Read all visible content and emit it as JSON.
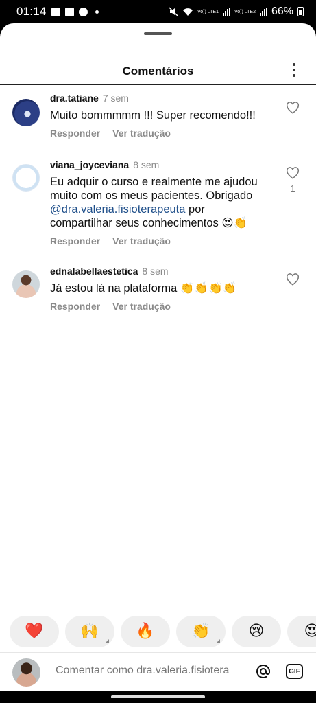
{
  "status_bar": {
    "time": "01:14",
    "battery": "66%",
    "sim1_label": "Vo)) LTE1",
    "sim2_label": "Vo)) LTE2"
  },
  "header": {
    "title": "Comentários"
  },
  "comments": [
    {
      "username": "dra.tatiane",
      "time": "7 sem",
      "text": "Muito bommmmm !!! Super recomendo!!!",
      "reply_label": "Responder",
      "translate_label": "Ver tradução",
      "likes": ""
    },
    {
      "username": "viana_joyceviana",
      "time": "8 sem",
      "text_before": "Eu adquir o curso e realmente me ajudou muito com os meus pacientes. Obrigado ",
      "mention": "@dra.valeria.fisioterapeuta",
      "text_after": " por compartilhar seus conhecimentos 😍👏",
      "reply_label": "Responder",
      "translate_label": "Ver tradução",
      "likes": "1"
    },
    {
      "username": "ednalabellaestetica",
      "time": "8 sem",
      "text": "Já estou lá na plataforma 👏👏👏👏",
      "reply_label": "Responder",
      "translate_label": "Ver tradução",
      "likes": ""
    }
  ],
  "emoji_bar": [
    "❤️",
    "🙌",
    "🔥",
    "👏",
    "😢",
    "😍"
  ],
  "composer": {
    "placeholder": "Comentar como dra.valeria.fisiotera",
    "gif_label": "GIF"
  }
}
